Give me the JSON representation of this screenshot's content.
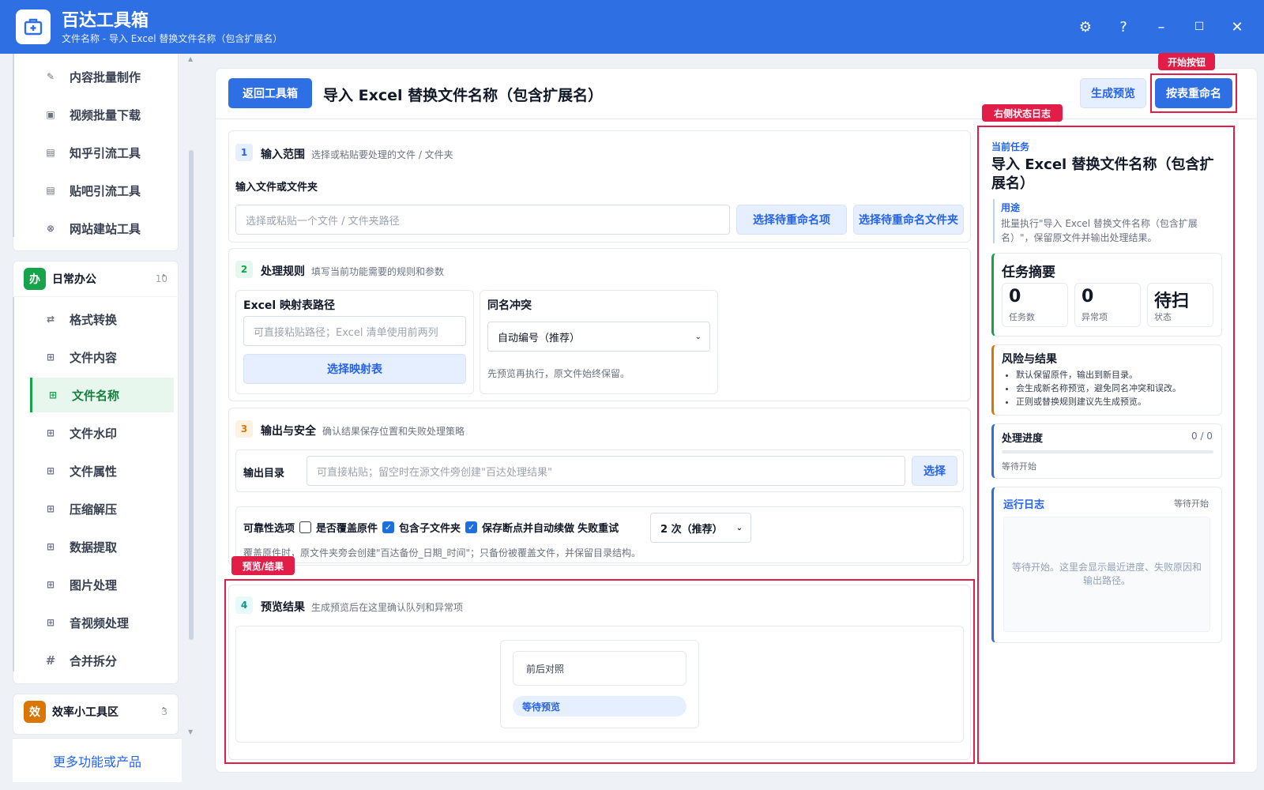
{
  "app": {
    "title": "百达工具箱",
    "subtitle": "文件名称 - 导入 Excel 替换文件名称（包含扩展名）",
    "controls": {
      "settings": "⚙",
      "help": "?",
      "minimize": "–",
      "maximize": "☐",
      "close": "✕"
    }
  },
  "sidebar": {
    "top_items": [
      {
        "label": "内容批量制作",
        "icon": "pen-icon"
      },
      {
        "label": "视频批量下载",
        "icon": "video-icon"
      },
      {
        "label": "知乎引流工具",
        "icon": "zhihu-icon"
      },
      {
        "label": "贴吧引流工具",
        "icon": "tieba-icon"
      },
      {
        "label": "网站建站工具",
        "icon": "globe-icon"
      }
    ],
    "group_office": {
      "badge": "办",
      "label": "日常办公",
      "count": "10",
      "chevron": "˄"
    },
    "office_items": [
      {
        "label": "格式转换",
        "icon": "swap-icon"
      },
      {
        "label": "文件内容",
        "icon": "grid-icon"
      },
      {
        "label": "文件名称",
        "icon": "grid-icon"
      },
      {
        "label": "文件水印",
        "icon": "grid-icon"
      },
      {
        "label": "文件属性",
        "icon": "grid-icon"
      },
      {
        "label": "压缩解压",
        "icon": "grid-icon"
      },
      {
        "label": "数据提取",
        "icon": "grid-icon"
      },
      {
        "label": "图片处理",
        "icon": "grid-icon"
      },
      {
        "label": "音视频处理",
        "icon": "grid-icon"
      },
      {
        "label": "合并拆分",
        "icon": "hash-icon"
      }
    ],
    "group_tools": {
      "badge": "效",
      "label": "效率小工具区",
      "count": "3",
      "chevron": "˄"
    },
    "more_link": "更多功能或产品"
  },
  "header": {
    "back_button": "返回工具箱",
    "title": "导入 Excel 替换文件名称（包含扩展名）",
    "preview_button": "生成预览",
    "start_button": "按表重命名"
  },
  "annotations": {
    "start_tag": "开始按钮",
    "log_tag": "右侧状态日志",
    "preview_tag": "预览/结果"
  },
  "section1": {
    "step": "1",
    "title": "输入范围",
    "desc": "选择或粘贴要处理的文件 / 文件夹",
    "field_label": "输入文件或文件夹",
    "placeholder": "选择或粘贴一个文件 / 文件夹路径",
    "btn_items": "选择待重命名项",
    "btn_folder": "选择待重命名文件夹"
  },
  "section2": {
    "step": "2",
    "title": "处理规则",
    "desc": "填写当前功能需要的规则和参数",
    "excel_label": "Excel 映射表路径",
    "excel_placeholder": "可直接粘贴路径；Excel 清单使用前两列",
    "excel_button": "选择映射表",
    "conflict_label": "同名冲突",
    "conflict_value": "自动编号（推荐）",
    "conflict_hint": "先预览再执行，原文件始终保留。"
  },
  "section3": {
    "step": "3",
    "title": "输出与安全",
    "desc": "确认结果保存位置和失败处理策略",
    "output_label": "输出目录",
    "output_placeholder": "可直接粘贴；留空时在源文件旁创建\"百达处理结果\"",
    "output_button": "选择",
    "reliability_label": "可靠性选项",
    "opt_overwrite": "是否覆盖原件",
    "opt_overwrite_checked": false,
    "opt_subfolders": "包含子文件夹",
    "opt_subfolders_checked": true,
    "opt_resume": "保存断点并自动续做",
    "opt_resume_checked": true,
    "retry_label": "失败重试",
    "retry_value": "2 次（推荐）",
    "note": "覆盖原件时，原文件夹旁会创建\"百达备份_日期_时间\"；只备份被覆盖文件，并保留目录结构。"
  },
  "section4": {
    "step": "4",
    "title": "预览结果",
    "desc": "生成预览后在这里确认队列和异常项",
    "compare_label": "前后对照",
    "status_pill": "等待预览"
  },
  "right": {
    "task_label": "当前任务",
    "task_title": "导入 Excel 替换文件名称（包含扩展名）",
    "purpose_label": "用途",
    "purpose_text": "批量执行\"导入 Excel 替换文件名称（包含扩展名）\"，保留原文件并输出处理结果。",
    "summary_title": "任务摘要",
    "stats": [
      {
        "value": "0",
        "label": "任务数"
      },
      {
        "value": "0",
        "label": "异常项"
      },
      {
        "value": "待扫",
        "label": "状态"
      }
    ],
    "risk_title": "风险与结果",
    "risk_items": [
      "默认保留原件，输出到新目录。",
      "会生成新名称预览，避免同名冲突和误改。",
      "正则或替换规则建议先生成预览。"
    ],
    "progress_title": "处理进度",
    "progress_count": "0 / 0",
    "progress_fraction": 0,
    "progress_status": "等待开始",
    "log_title": "运行日志",
    "log_status": "等待开始",
    "log_placeholder": "等待开始。这里会显示最近进度、失败原因和输出路径。"
  },
  "colors": {
    "accent": "#2f6fe4",
    "active_green": "#16a34a",
    "annotation_red": "#e11d48"
  }
}
